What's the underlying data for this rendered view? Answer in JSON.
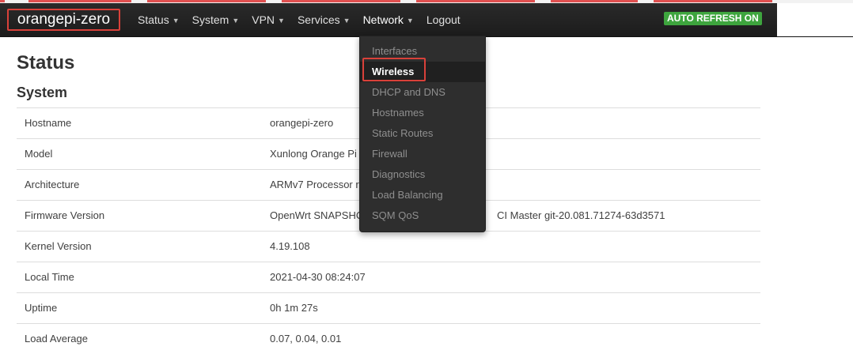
{
  "navbar": {
    "brand": "orangepi-zero",
    "menu": [
      {
        "label": "Status",
        "caret": "▼"
      },
      {
        "label": "System",
        "caret": "▼"
      },
      {
        "label": "VPN",
        "caret": "▼"
      },
      {
        "label": "Services",
        "caret": "▼"
      },
      {
        "label": "Network",
        "caret": "▼"
      },
      {
        "label": "Logout",
        "caret": ""
      }
    ],
    "auto_refresh": "AUTO REFRESH ON"
  },
  "network_menu": {
    "items": [
      {
        "label": "Interfaces"
      },
      {
        "label": "Wireless",
        "active": true
      },
      {
        "label": "DHCP and DNS"
      },
      {
        "label": "Hostnames"
      },
      {
        "label": "Static Routes"
      },
      {
        "label": "Firewall"
      },
      {
        "label": "Diagnostics"
      },
      {
        "label": "Load Balancing"
      },
      {
        "label": "SQM QoS"
      }
    ]
  },
  "main": {
    "title": "Status",
    "section": "System",
    "rows": [
      {
        "key": "Hostname",
        "value": "orangepi-zero"
      },
      {
        "key": "Model",
        "value": "Xunlong Orange Pi"
      },
      {
        "key": "Architecture",
        "value": "ARMv7 Processor r"
      },
      {
        "key": "Firmware Version",
        "value": "OpenWrt SNAPSHO"
      },
      {
        "key": "Kernel Version",
        "value": "4.19.108"
      },
      {
        "key": "Local Time",
        "value": "2021-04-30 08:24:07"
      },
      {
        "key": "Uptime",
        "value": "0h 1m 27s"
      },
      {
        "key": "Load Average",
        "value": "0.07, 0.04, 0.01"
      }
    ],
    "firmware_tail": "CI Master git-20.081.71274-63d3571"
  },
  "colors": {
    "navbar_bg": "#1f1f1f",
    "highlight_border": "#d9413a",
    "auto_refresh_bg": "#3ea53e"
  }
}
